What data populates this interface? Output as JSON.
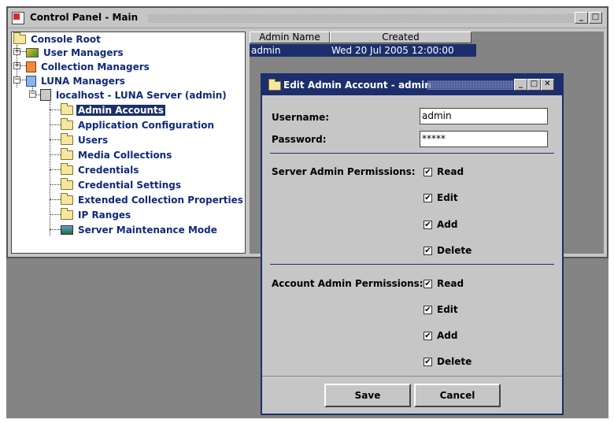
{
  "main_window": {
    "title": "Control Panel - Main",
    "buttons": [
      "_",
      "□"
    ]
  },
  "tree": {
    "root": "Console Root",
    "user_managers": "User Managers",
    "collection_managers": "Collection Managers",
    "luna_managers": "LUNA Managers",
    "server": "localhost - LUNA Server (admin)",
    "children": [
      "Admin Accounts",
      "Application Configuration",
      "Users",
      "Media Collections",
      "Credentials",
      "Credential Settings",
      "Extended Collection Properties",
      "IP Ranges",
      "Server Maintenance Mode"
    ],
    "selected": "Admin Accounts"
  },
  "table": {
    "columns": [
      "Admin Name",
      "Created"
    ],
    "rows": [
      {
        "name": "admin",
        "created": "Wed 20 Jul 2005 12:00:00"
      }
    ]
  },
  "dialog": {
    "title": "Edit Admin Account - admin",
    "username_label": "Username:",
    "username_value": "admin",
    "password_label": "Password:",
    "password_value": "*****",
    "server_perm_label": "Server Admin Permissions:",
    "account_perm_label": "Account Admin Permissions:",
    "permissions": [
      "Read",
      "Edit",
      "Add",
      "Delete"
    ],
    "check_mark": "✔",
    "save": "Save",
    "cancel": "Cancel"
  }
}
